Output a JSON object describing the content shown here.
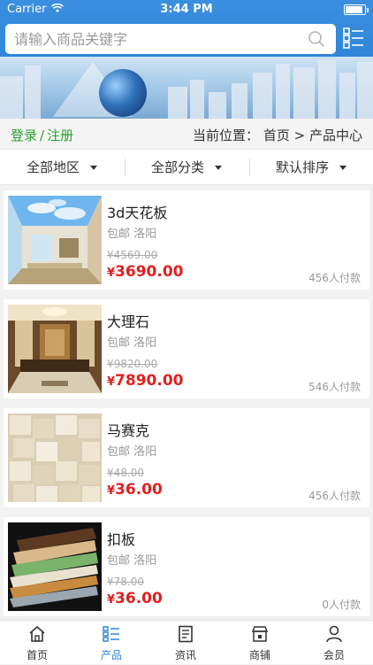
{
  "status_bar": {
    "carrier": "Carrier",
    "time": "3:44 PM"
  },
  "search": {
    "placeholder": "请输入商品关键字"
  },
  "login": {
    "login_label": "登录",
    "separator": "/",
    "register_label": "注册"
  },
  "breadcrumb": {
    "prefix": "当前位置：",
    "home": "首页",
    "arrow": ">",
    "current": "产品中心"
  },
  "filters": [
    {
      "label": "全部地区"
    },
    {
      "label": "全部分类"
    },
    {
      "label": "默认排序"
    }
  ],
  "products": [
    {
      "title": "3d天花板",
      "meta": "包邮 洛阳",
      "old_price": "¥4569.00",
      "currency": "¥",
      "price": "3690.00",
      "sold": "456人付款"
    },
    {
      "title": "大理石",
      "meta": "包邮 洛阳",
      "old_price": "¥9820.00",
      "currency": "¥",
      "price": "7890.00",
      "sold": "546人付款"
    },
    {
      "title": "马赛克",
      "meta": "包邮 洛阳",
      "old_price": "¥48.00",
      "currency": "¥",
      "price": "36.00",
      "sold": "456人付款"
    },
    {
      "title": "扣板",
      "meta": "包邮 洛阳",
      "old_price": "¥78.00",
      "currency": "¥",
      "price": "36.00",
      "sold": "0人付款"
    }
  ],
  "tabs": [
    {
      "label": "首页",
      "icon": "home-icon"
    },
    {
      "label": "产品",
      "icon": "product-list-icon",
      "active": true
    },
    {
      "label": "资讯",
      "icon": "news-icon"
    },
    {
      "label": "商铺",
      "icon": "shop-icon"
    },
    {
      "label": "会员",
      "icon": "member-icon"
    }
  ],
  "colors": {
    "accent": "#2f86d9",
    "price": "#e0201f",
    "login": "#2aa22a"
  }
}
